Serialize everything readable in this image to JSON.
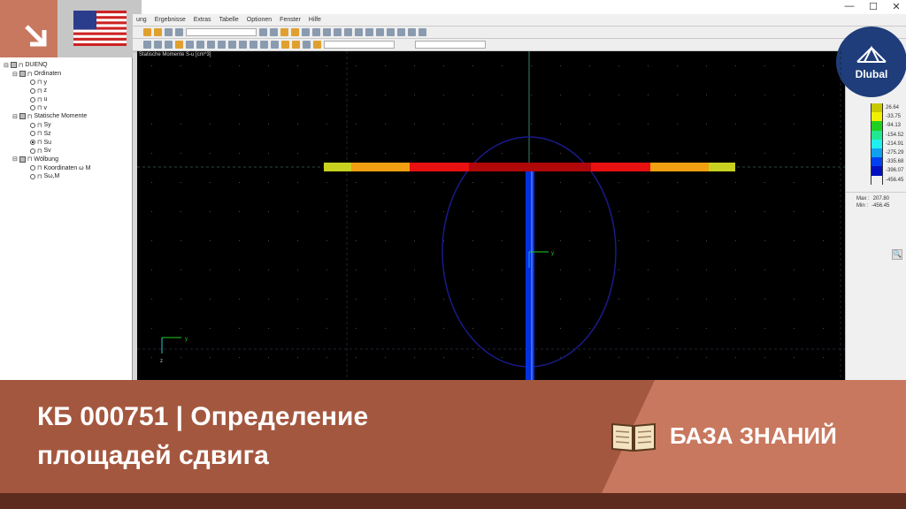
{
  "window": {
    "minimize": "—",
    "maximize": "☐",
    "close": "✕"
  },
  "menu": [
    "ung",
    "Ergebnisse",
    "Extras",
    "Tabelle",
    "Optionen",
    "Fenster",
    "Hilfe"
  ],
  "tree": {
    "root": "DUENQ",
    "groups": [
      {
        "label": "Ordinaten",
        "items": [
          {
            "label": "y",
            "selected": false
          },
          {
            "label": "z",
            "selected": false
          },
          {
            "label": "u",
            "selected": false
          },
          {
            "label": "v",
            "selected": false
          }
        ]
      },
      {
        "label": "Statische Momente",
        "items": [
          {
            "label": "Sy",
            "selected": false
          },
          {
            "label": "Sz",
            "selected": false
          },
          {
            "label": "Su",
            "selected": true
          },
          {
            "label": "Sv",
            "selected": false
          }
        ]
      },
      {
        "label": "Wölbung",
        "items": [
          {
            "label": "Koordinaten ω M",
            "selected": false
          },
          {
            "label": "Sω,M",
            "selected": false
          }
        ]
      }
    ]
  },
  "canvas": {
    "title": "Statische Momente S-u [cm^3]",
    "axis_y": "y",
    "axis_z": "z"
  },
  "legend": {
    "values": [
      "26.64",
      "-33.75",
      "-94.13",
      "-154.52",
      "-214.91",
      "-275.29",
      "-335.68",
      "-396.07",
      "-456.45"
    ],
    "colors": [
      "#c8c800",
      "#f0f000",
      "#20d020",
      "#20e890",
      "#20f0f0",
      "#10a0f0",
      "#0040f0",
      "#0010c0"
    ],
    "max_label": "Max :",
    "max": "207.80",
    "min_label": "Min :",
    "min": "-456.45"
  },
  "logo": "Dlubal",
  "banner": {
    "title_line1": "КБ 000751 | Определение",
    "title_line2": "площадей сдвига",
    "kb": "БАЗА ЗНАНИЙ"
  }
}
